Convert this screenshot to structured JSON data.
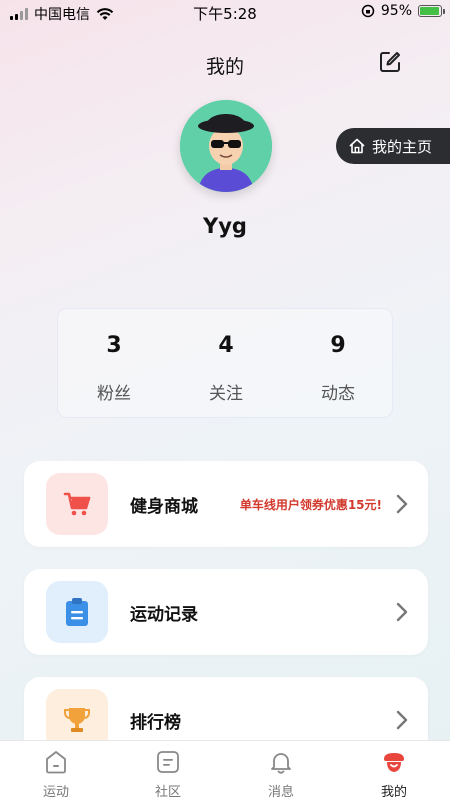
{
  "status_bar": {
    "carrier": "中国电信",
    "time": "下午5:28",
    "battery": "95%",
    "battery_level": 0.95
  },
  "header": {
    "title": "我的"
  },
  "home_button": {
    "label": "我的主页"
  },
  "profile": {
    "username": "Yyg"
  },
  "stats": [
    {
      "value": "3",
      "label": "粉丝"
    },
    {
      "value": "4",
      "label": "关注"
    },
    {
      "value": "9",
      "label": "动态"
    }
  ],
  "menu": {
    "shop": {
      "label": "健身商城",
      "promo": "单车线用户领券优惠15元!",
      "icon": "shopping-cart-icon",
      "color": "#f0504a"
    },
    "records": {
      "label": "运动记录",
      "icon": "clipboard-icon",
      "color": "#3b8fe6"
    },
    "ranking": {
      "label": "排行榜",
      "icon": "trophy-icon",
      "color": "#f2a23a"
    }
  },
  "tabs": [
    {
      "label": "运动",
      "icon": "sport-icon"
    },
    {
      "label": "社区",
      "icon": "community-icon"
    },
    {
      "label": "消息",
      "icon": "bell-icon"
    },
    {
      "label": "我的",
      "icon": "profile-icon",
      "active": true
    }
  ],
  "colors": {
    "accent": "#e8453c",
    "home_pill": "#2b2d30"
  }
}
